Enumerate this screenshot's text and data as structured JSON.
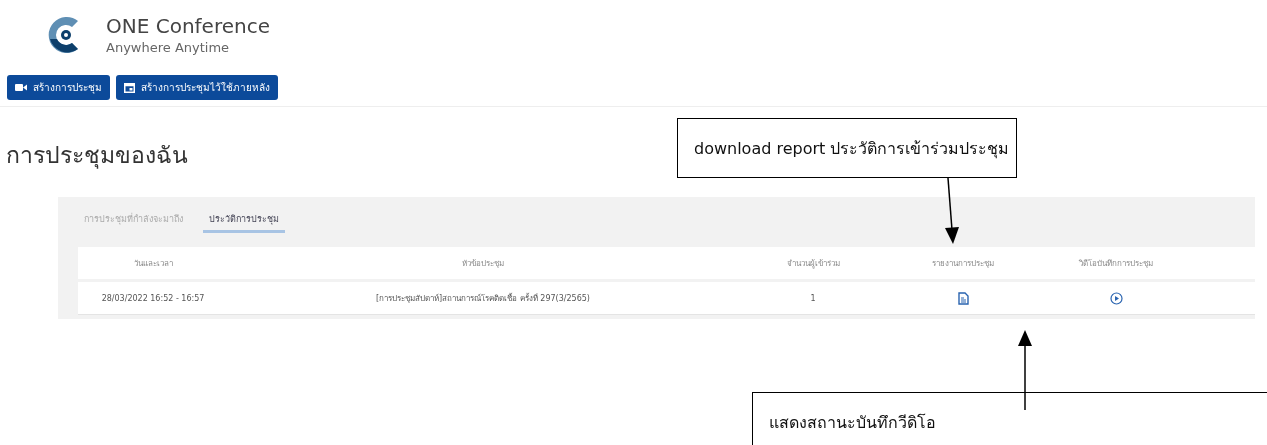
{
  "brand": {
    "title": "ONE Conference",
    "subtitle": "Anywhere Anytime"
  },
  "actions": [
    {
      "kind": "video",
      "label": "สร้างการประชุม"
    },
    {
      "kind": "calendar",
      "label": "สร้างการประชุมไว้ใช้ภายหลัง"
    }
  ],
  "page_title": "การประชุมของฉัน",
  "tabs": [
    {
      "label": "การประชุมที่กำลังจะมาถึง",
      "selected": false
    },
    {
      "label": "ประวัติการประชุม",
      "selected": true
    }
  ],
  "table": {
    "columns": [
      "วันและเวลา",
      "หัวข้อประชุม",
      "จำนวนผู้เข้าร่วม",
      "รายงานการประชุม",
      "วิดีโอบันทึกการประชุม"
    ],
    "rows": [
      {
        "datetime": "28/03/2022 16:52 - 16:57",
        "topic": "[การประชุมสัปดาห์]สถานการณ์โรคติดเชื้อ ครั้งที่ 297(3/2565)",
        "participants": "1"
      }
    ]
  },
  "annotations": [
    {
      "kind": "report",
      "text": "download report ประวัติการเข้าร่วมประชุม"
    },
    {
      "kind": "video",
      "text": "แสดงสถานะบันทึกวีดิโอ"
    }
  ]
}
